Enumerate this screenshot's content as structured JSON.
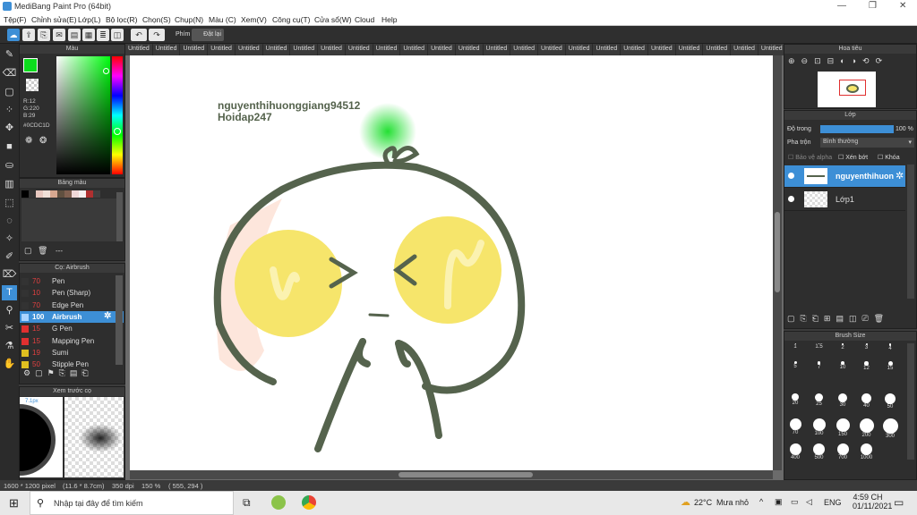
{
  "window": {
    "title": "MediBang Paint Pro (64bit)"
  },
  "menu": [
    "Tệp(F)",
    "Chỉnh sửa(E)",
    "Lớp(L)",
    "Bộ lọc(R)",
    "Chọn(S)",
    "Chụp(N)",
    "Màu (C)",
    "Xem(V)",
    "Công cụ(T)",
    "Cửa sổ(W)",
    "Cloud",
    "Help"
  ],
  "toolbar": {
    "keys_label": "Phím",
    "reset_label": "Đặt lại"
  },
  "color_panel": {
    "title": "Màu",
    "r": "R:12",
    "g": "G:220",
    "b": "B:29",
    "hex": "#0CDC1D",
    "fg": "#0cdc1d"
  },
  "palette_panel": {
    "title": "Bảng màu",
    "more": "---"
  },
  "brush_panel": {
    "title": "Cọ: Airbrush",
    "items": [
      {
        "size": "70",
        "label": "Pen",
        "color": "#333333"
      },
      {
        "size": "10",
        "label": "Pen (Sharp)",
        "color": "#333333"
      },
      {
        "size": "70",
        "label": "Edge Pen",
        "color": "#333333"
      },
      {
        "size": "100",
        "label": "Airbrush",
        "color": "#aad4ff"
      },
      {
        "size": "15",
        "label": "G Pen",
        "color": "#e03030"
      },
      {
        "size": "15",
        "label": "Mapping Pen",
        "color": "#e03030"
      },
      {
        "size": "19",
        "label": "Sumi",
        "color": "#e0c020"
      },
      {
        "size": "50",
        "label": "Stipple Pen",
        "color": "#e0c020"
      }
    ]
  },
  "preview_panel": {
    "title": "Xem trước cọ",
    "size_label": "7.1px"
  },
  "tabs": [
    "Untitled",
    "Untitled",
    "Untitled",
    "Untitled",
    "Untitled",
    "Untitled",
    "Untitled",
    "Untitled",
    "Untitled",
    "Untitled",
    "Untitled",
    "Untitled",
    "Untitled",
    "Untitled",
    "Untitled",
    "Untitled",
    "Untitled",
    "Untitled",
    "Untitled",
    "Untitled",
    "Untitled",
    "Untitled",
    "Untitled",
    "Untitled",
    "Untitled",
    "Untitled",
    "Untitled",
    "Untitled",
    "Untitled",
    "Untitled",
    "Untitled",
    "Untitled"
  ],
  "canvas_text": {
    "line1": "nguyenthihuonggiang94512",
    "line2": "Hoidap247"
  },
  "navigator": {
    "title": "Hoa tiêu"
  },
  "layer_panel": {
    "title": "Lớp",
    "opacity_label": "Độ trong",
    "opacity_value": "100 %",
    "blend_label": "Pha trộn",
    "blend_value": "Bình thường",
    "protect_alpha": "Bảo vệ alpha",
    "clip": "Xén bớt",
    "lock": "Khóa",
    "layers": [
      {
        "name": "nguyenthihuon"
      },
      {
        "name": "Lớp1"
      }
    ]
  },
  "brush_size": {
    "title": "Brush Size",
    "sizes": [
      "1",
      "1.5",
      "2",
      "3",
      "4",
      "5",
      "7",
      "10",
      "12",
      "15",
      "20",
      "25",
      "30",
      "40",
      "50",
      "70",
      "100",
      "150",
      "200",
      "300",
      "400",
      "500",
      "700",
      "1000"
    ]
  },
  "status": {
    "dimensions": "1600 * 1200 pixel",
    "physical": "(11.6 * 8.7cm)",
    "dpi": "350 dpi",
    "zoom": "150 %",
    "coords": "( 555, 294 )"
  },
  "taskbar": {
    "search_placeholder": "Nhập tại đây để tìm kiếm",
    "weather_temp": "22°C",
    "weather_text": "Mưa nhỏ",
    "lang": "ENG",
    "time": "4:59 CH",
    "date": "01/11/2021"
  }
}
